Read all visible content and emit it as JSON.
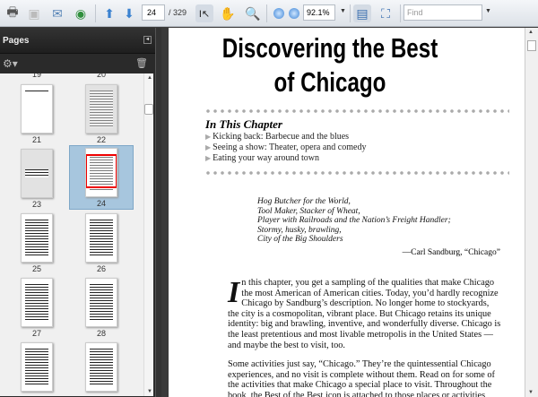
{
  "toolbar": {
    "page_current": "24",
    "page_total": "/ 329",
    "zoom": "92.1%",
    "find_placeholder": "Find"
  },
  "sidebar": {
    "title": "Pages",
    "thumbnails": [
      {
        "label": "21"
      },
      {
        "label": "22"
      },
      {
        "label": "23"
      },
      {
        "label": "24",
        "selected": true
      },
      {
        "label": "25"
      },
      {
        "label": "26"
      },
      {
        "label": "27"
      },
      {
        "label": "28"
      }
    ],
    "top_labels": [
      "19",
      "20"
    ]
  },
  "document": {
    "title_line1": "Discovering the Best",
    "title_line2": "of Chicago",
    "chapter_heading": "In This Chapter",
    "bullets": [
      "Kicking back: Barbecue and the blues",
      "Seeing a show: Theater, opera and comedy",
      "Eating your way around town"
    ],
    "quote_lines": [
      "Hog Butcher for the World,",
      "Tool Maker, Stacker of Wheat,",
      "Player with Railroads and the Nation’s Freight Handler;",
      "Stormy, husky, brawling,",
      "City of the Big Shoulders"
    ],
    "attribution": "—Carl Sandburg, “Chicago”",
    "dropcap": "I",
    "para1": "n this chapter, you get a sampling of the qualities that make Chicago the most American of American cities. Today, you’d hardly recognize Chicago by Sandburg’s description. No longer home to stockyards, the city is a cosmopolitan, vibrant place. But Chicago retains its unique identity: big and brawling, inventive, and wonderfully diverse. Chicago is the least pretentious and most livable metropolis in the United States — and maybe the best to visit, too.",
    "para2": "Some activities just say, “Chicago.” They’re the quintessential Chicago experiences, and no visit is complete without them. Read on for some of the activities that make Chicago a special place to visit. Throughout the book, the Best of the Best icon is attached to those places or activities"
  }
}
